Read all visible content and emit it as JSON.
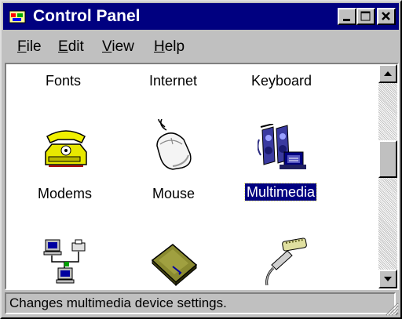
{
  "window": {
    "title": "Control Panel"
  },
  "menu": [
    {
      "label": "File",
      "accel": "F",
      "rest": "ile"
    },
    {
      "label": "Edit",
      "accel": "E",
      "rest": "dit"
    },
    {
      "label": "View",
      "accel": "V",
      "rest": "iew"
    },
    {
      "label": "Help",
      "accel": "H",
      "rest": "elp"
    }
  ],
  "items": {
    "fonts": "Fonts",
    "internet": "Internet",
    "keyboard": "Keyboard",
    "modems": "Modems",
    "mouse": "Mouse",
    "multimedia": "Multimedia"
  },
  "selected_item": "Multimedia",
  "status": "Changes multimedia device settings.",
  "icons": {
    "app": "control-panel-icon",
    "modems": "telephone-icon",
    "mouse": "mouse-icon",
    "multimedia": "multimedia-icon",
    "network": "network-icon",
    "pc_card": "pc-card-icon",
    "ports": "cable-icon"
  },
  "colors": {
    "title_bar": "#000080",
    "face": "#c0c0c0",
    "selection": "#000080"
  }
}
